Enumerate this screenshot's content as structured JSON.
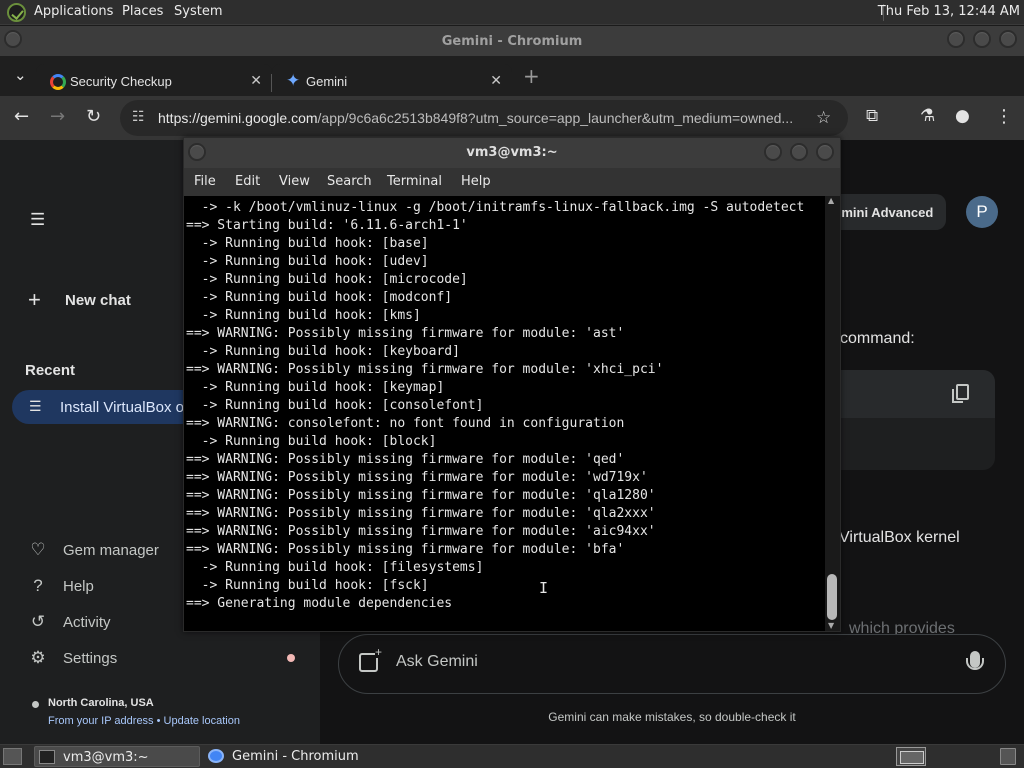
{
  "top_panel": {
    "menus": [
      "Applications",
      "Places",
      "System"
    ],
    "clock": "Thu Feb 13, 12:44 AM"
  },
  "browser": {
    "window_title": "Gemini - Chromium",
    "tabs": [
      {
        "label": "Security Checkup",
        "icon": "google-g-icon",
        "close": "✕"
      },
      {
        "label": "Gemini",
        "icon": "gemini-sparkle-icon",
        "close": "✕"
      }
    ],
    "new_tab": "+",
    "tab_list": "⌄",
    "url_host": "https://gemini.google.com",
    "url_rest": "/app/9c6a6c2513b849f8?utm_source=app_launcher&utm_medium=owned..."
  },
  "gemini": {
    "new_chat": "New chat",
    "recent_label": "Recent",
    "recent_item": "Install VirtualBox on Arch Linux",
    "links": [
      {
        "icon": "gem-icon",
        "glyph": "♡",
        "label": "Gem manager"
      },
      {
        "icon": "help-icon",
        "glyph": "?",
        "label": "Help"
      },
      {
        "icon": "activity-icon",
        "glyph": "↺",
        "label": "Activity"
      },
      {
        "icon": "settings-icon",
        "glyph": "⚙",
        "label": "Settings"
      }
    ],
    "location": "North Carolina, USA",
    "ip_line": "From your IP address • Update location",
    "advanced": "Gemini Advanced",
    "avatar_letter": "P",
    "answer_line_1": "command:",
    "answer_line_2": "VirtualBox kernel",
    "answer_line_3": "which provides",
    "ask_placeholder": "Ask Gemini",
    "disclaimer": "Gemini can make mistakes, so double-check it"
  },
  "terminal": {
    "title": "vm3@vm3:~",
    "menus": [
      "File",
      "Edit",
      "View",
      "Search",
      "Terminal",
      "Help"
    ],
    "lines": [
      "  -> -k /boot/vmlinuz-linux -g /boot/initramfs-linux-fallback.img -S autodetect",
      "==> Starting build: '6.11.6-arch1-1'",
      "  -> Running build hook: [base]",
      "  -> Running build hook: [udev]",
      "  -> Running build hook: [microcode]",
      "  -> Running build hook: [modconf]",
      "  -> Running build hook: [kms]",
      "==> WARNING: Possibly missing firmware for module: 'ast'",
      "  -> Running build hook: [keyboard]",
      "==> WARNING: Possibly missing firmware for module: 'xhci_pci'",
      "  -> Running build hook: [keymap]",
      "  -> Running build hook: [consolefont]",
      "==> WARNING: consolefont: no font found in configuration",
      "  -> Running build hook: [block]",
      "==> WARNING: Possibly missing firmware for module: 'qed'",
      "==> WARNING: Possibly missing firmware for module: 'wd719x'",
      "==> WARNING: Possibly missing firmware for module: 'qla1280'",
      "==> WARNING: Possibly missing firmware for module: 'qla2xxx'",
      "==> WARNING: Possibly missing firmware for module: 'aic94xx'",
      "==> WARNING: Possibly missing firmware for module: 'bfa'",
      "  -> Running build hook: [filesystems]",
      "  -> Running build hook: [fsck]",
      "==> Generating module dependencies"
    ],
    "cursor_glyph": "I"
  },
  "taskbar": {
    "tasks": [
      {
        "label": "vm3@vm3:~",
        "icon": "terminal-icon"
      },
      {
        "label": "Gemini - Chromium",
        "icon": "chromium-icon"
      }
    ]
  },
  "colors": {
    "accent": "#a8c7fa",
    "recent_active": "#1f3760",
    "terminal_bg": "#000000"
  }
}
